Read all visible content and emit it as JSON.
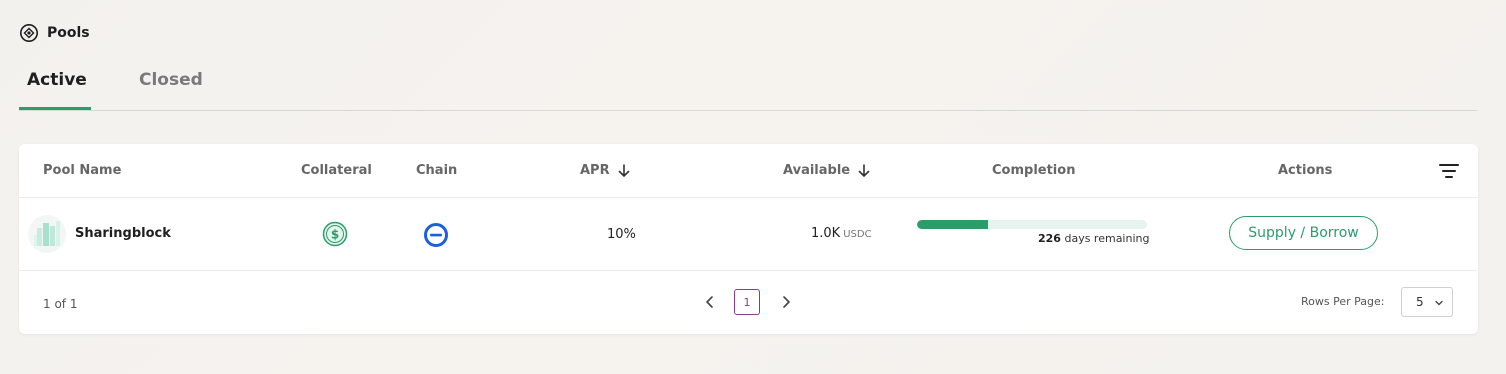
{
  "header": {
    "title": "Pools",
    "icon": "pools-icon"
  },
  "tabs": [
    {
      "label": "Active",
      "active": true
    },
    {
      "label": "Closed",
      "active": false
    }
  ],
  "table": {
    "columns": {
      "pool_name": "Pool Name",
      "collateral": "Collateral",
      "chain": "Chain",
      "apr": "APR",
      "available": "Available",
      "completion": "Completion",
      "actions": "Actions"
    },
    "rows": [
      {
        "pool_name": "Sharingblock",
        "collateral_icon": "dollar-circle-icon",
        "chain_icon": "chain-token-icon",
        "apr": "10%",
        "available": "1.0K",
        "available_unit": "USDC",
        "completion_fraction": 0.31,
        "days_remaining": "226",
        "days_label": "days remaining",
        "action_label": "Supply / Borrow"
      }
    ]
  },
  "pagination": {
    "page_info": "1 of 1",
    "current_page": "1",
    "rows_per_page_label": "Rows Per Page:",
    "rows_per_page": "5"
  },
  "colors": {
    "accent": "#2a9d69",
    "page_highlight": "#8a3a8e",
    "chain_blue": "#1a5fe0"
  }
}
